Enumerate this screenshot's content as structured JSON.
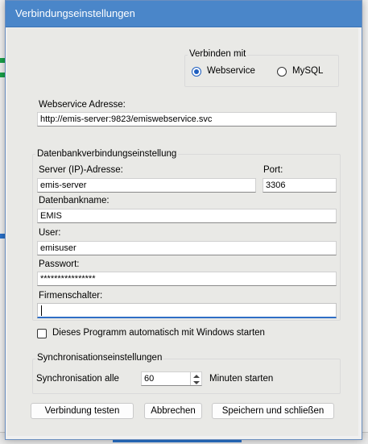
{
  "dialog": {
    "title": "Verbindungseinstellungen"
  },
  "connect_with": {
    "title": "Verbinden mit",
    "options": [
      "Webservice",
      "MySQL"
    ],
    "selected": "Webservice"
  },
  "webservice": {
    "label": "Webservice Adresse:",
    "value": "http://emis-server:9823/emiswebservice.svc"
  },
  "db": {
    "group_title": "Datenbankverbindungseinstellung",
    "server_label": "Server (IP)-Adresse:",
    "server_value": "emis-server",
    "port_label": "Port:",
    "port_value": "3306",
    "dbname_label": "Datenbankname:",
    "dbname_value": "EMIS",
    "user_label": "User:",
    "user_value": "emisuser",
    "password_label": "Passwort:",
    "password_value": "****************",
    "company_label": "Firmenschalter:",
    "company_value": ""
  },
  "autostart": {
    "label": "Dieses Programm automatisch mit Windows starten",
    "checked": false
  },
  "sync": {
    "group_title": "Synchronisationseinstellungen",
    "prefix": "Synchronisation alle",
    "value": "60",
    "suffix": "Minuten starten"
  },
  "buttons": {
    "test": "Verbindung testen",
    "cancel": "Abbrechen",
    "save": "Speichern und schließen"
  }
}
